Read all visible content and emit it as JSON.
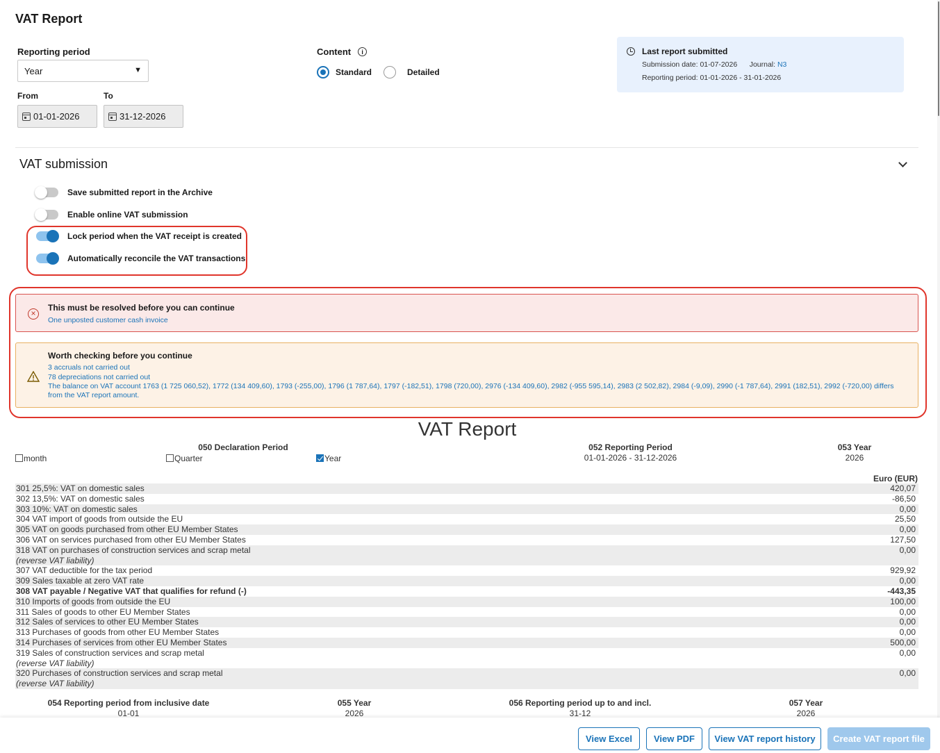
{
  "title": "VAT Report",
  "period": {
    "label": "Reporting period",
    "value": "Year",
    "from_label": "From",
    "from": "01-01-2026",
    "to_label": "To",
    "to": "31-12-2026"
  },
  "content": {
    "label": "Content",
    "standard": "Standard",
    "detailed": "Detailed",
    "selected": "Standard"
  },
  "last_report": {
    "title": "Last report submitted",
    "date_label": "Submission date: 01-07-2026",
    "journal_label": "Journal:",
    "journal": "N3",
    "period": "Reporting period: 01-01-2026 - 31-01-2026"
  },
  "submission": {
    "title": "VAT submission",
    "toggles": [
      {
        "label": "Save submitted report in the Archive",
        "on": false
      },
      {
        "label": "Enable online VAT submission",
        "on": false
      },
      {
        "label": "Lock period when the VAT receipt is created",
        "on": true
      },
      {
        "label": "Automatically reconcile the VAT transactions",
        "on": true
      }
    ]
  },
  "alerts": {
    "error": {
      "title": "This must be resolved before you can continue",
      "items": [
        "One unposted customer cash invoice"
      ]
    },
    "warning": {
      "title": "Worth checking before you continue",
      "items": [
        "3 accruals not carried out",
        "78 depreciations not carried out",
        "The balance on VAT account 1763 (1 725 060,52), 1772 (134 409,60), 1793 (-255,00), 1796 (1 787,64), 1797 (-182,51), 1798 (720,00), 2976 (-134 409,60), 2982 (-955 595,14), 2983 (2 502,82), 2984 (-9,09), 2990 (-1 787,64), 2991 (182,51), 2992 (-720,00) differs",
        "from the VAT report amount."
      ]
    }
  },
  "report": {
    "title": "VAT Report",
    "decl_period": "050 Declaration Period",
    "month": "month",
    "quarter": "Quarter",
    "year": "Year",
    "rep_period_label": "052 Reporting Period",
    "rep_period": "01-01-2026 - 31-12-2026",
    "year_label": "053 Year",
    "year_value": "2026",
    "currency": "Euro (EUR)",
    "rows": [
      {
        "code": "301 25,5%: VAT on domestic sales",
        "note": "",
        "value": "420,07",
        "bold": false
      },
      {
        "code": "302 13,5%: VAT on domestic sales",
        "note": "",
        "value": "-86,50",
        "bold": false
      },
      {
        "code": "303 10%: VAT on domestic sales",
        "note": "",
        "value": "0,00",
        "bold": false
      },
      {
        "code": "304 VAT import of goods from outside the EU",
        "note": "",
        "value": "25,50",
        "bold": false
      },
      {
        "code": "305 VAT on goods purchased from other EU Member States",
        "note": "",
        "value": "0,00",
        "bold": false
      },
      {
        "code": "306 VAT on services purchased from other EU Member States",
        "note": "",
        "value": "127,50",
        "bold": false
      },
      {
        "code": "318 VAT on purchases of construction services and scrap metal",
        "note": "(reverse VAT liability)",
        "value": "0,00",
        "bold": false
      },
      {
        "code": "307 VAT deductible for the tax period",
        "note": "",
        "value": "929,92",
        "bold": false
      },
      {
        "code": "309 Sales taxable at zero VAT rate",
        "note": "",
        "value": "0,00",
        "bold": false
      },
      {
        "code": "308 VAT payable / Negative VAT that qualifies for refund (-)",
        "note": "",
        "value": "-443,35",
        "bold": true
      },
      {
        "code": "310 Imports of goods from outside the EU",
        "note": "",
        "value": "100,00",
        "bold": false
      },
      {
        "code": "311 Sales of goods to other EU Member States",
        "note": "",
        "value": "0,00",
        "bold": false
      },
      {
        "code": "312 Sales of services to other EU Member States",
        "note": "",
        "value": "0,00",
        "bold": false
      },
      {
        "code": "313 Purchases of goods from other EU Member States",
        "note": "",
        "value": "0,00",
        "bold": false
      },
      {
        "code": "314 Purchases of services from other EU Member States",
        "note": "",
        "value": "500,00",
        "bold": false
      },
      {
        "code": "319 Sales of construction services and scrap metal",
        "note": "(reverse VAT liability)",
        "value": "0,00",
        "bold": false
      },
      {
        "code": "320 Purchases of construction services and scrap metal",
        "note": "(reverse VAT liability)",
        "value": "0,00",
        "bold": false
      }
    ],
    "bottom": [
      {
        "label": "054 Reporting period from inclusive date",
        "value": "01-01"
      },
      {
        "label": "055 Year",
        "value": "2026"
      },
      {
        "label": "056 Reporting period up to and incl.",
        "value": "31-12"
      },
      {
        "label": "057 Year",
        "value": "2026"
      }
    ]
  },
  "buttons": {
    "excel": "View Excel",
    "pdf": "View PDF",
    "history": "View VAT report history",
    "create": "Create VAT report file"
  },
  "colors": {
    "accent": "#1a73b8",
    "error_bg": "#fbe9e8",
    "warn_bg": "#fdf2e6",
    "highlight": "#e0352b"
  }
}
